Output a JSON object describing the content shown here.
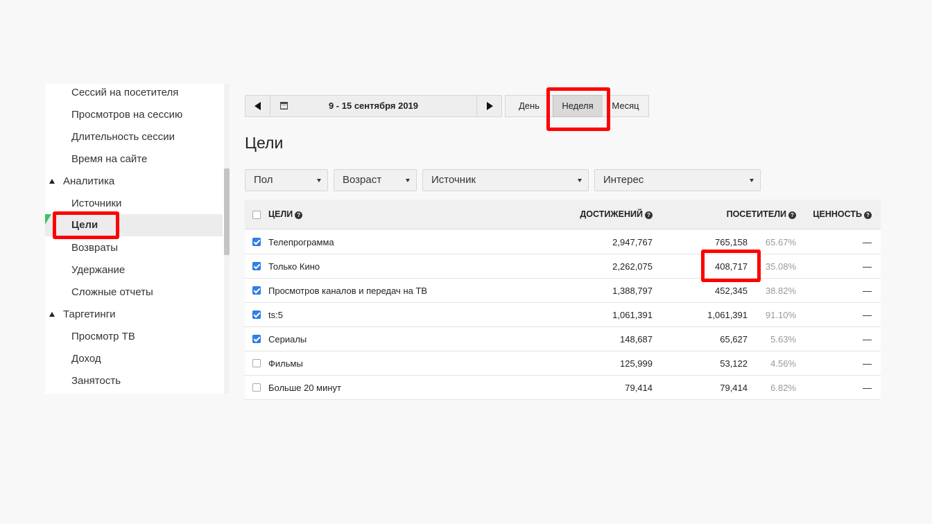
{
  "sidebar": {
    "items": [
      {
        "label": "Сессий на посетителя",
        "type": "item"
      },
      {
        "label": "Просмотров на сессию",
        "type": "item"
      },
      {
        "label": "Длительность сессии",
        "type": "item"
      },
      {
        "label": "Время на сайте",
        "type": "item"
      },
      {
        "label": "Аналитика",
        "type": "section"
      },
      {
        "label": "Источники",
        "type": "item"
      },
      {
        "label": "Цели",
        "type": "item",
        "active": true
      },
      {
        "label": "Возвраты",
        "type": "item"
      },
      {
        "label": "Удержание",
        "type": "item"
      },
      {
        "label": "Сложные отчеты",
        "type": "item"
      },
      {
        "label": "Таргетинги",
        "type": "section"
      },
      {
        "label": "Просмотр ТВ",
        "type": "item"
      },
      {
        "label": "Доход",
        "type": "item"
      },
      {
        "label": "Занятость",
        "type": "item"
      }
    ]
  },
  "toolbar": {
    "date_range": "9 - 15 сентября 2019",
    "periods": [
      "День",
      "Неделя",
      "Месяц"
    ],
    "active_period": "Неделя"
  },
  "page": {
    "title": "Цели"
  },
  "filters": [
    {
      "label": "Пол"
    },
    {
      "label": "Возраст"
    },
    {
      "label": "Источник"
    },
    {
      "label": "Интерес"
    }
  ],
  "table": {
    "headers": {
      "goals": "ЦЕЛИ",
      "achievements": "ДОСТИЖЕНИЙ",
      "visitors": "ПОСЕТИТЕЛИ",
      "value": "ЦЕННОСТЬ"
    },
    "help_glyph": "?",
    "rows": [
      {
        "name": "Телепрограмма",
        "checked": true,
        "achievements": "2,947,767",
        "visitors": "765,158",
        "percent": "65.67%",
        "value": "—"
      },
      {
        "name": "Только Кино",
        "checked": true,
        "achievements": "2,262,075",
        "visitors": "408,717",
        "percent": "35.08%",
        "value": "—"
      },
      {
        "name": "Просмотров каналов и передач на ТВ",
        "checked": true,
        "achievements": "1,388,797",
        "visitors": "452,345",
        "percent": "38.82%",
        "value": "—"
      },
      {
        "name": "ts:5",
        "checked": true,
        "achievements": "1,061,391",
        "visitors": "1,061,391",
        "percent": "91.10%",
        "value": "—"
      },
      {
        "name": "Сериалы",
        "checked": true,
        "achievements": "148,687",
        "visitors": "65,627",
        "percent": "5.63%",
        "value": "—"
      },
      {
        "name": "Фильмы",
        "checked": false,
        "achievements": "125,999",
        "visitors": "53,122",
        "percent": "4.56%",
        "value": "—"
      },
      {
        "name": "Больше 20 минут",
        "checked": false,
        "achievements": "79,414",
        "visitors": "79,414",
        "percent": "6.82%",
        "value": "—"
      }
    ]
  },
  "colors": {
    "highlight": "#ff0000",
    "checkbox": "#2f80ed",
    "percent_text": "#999999"
  }
}
